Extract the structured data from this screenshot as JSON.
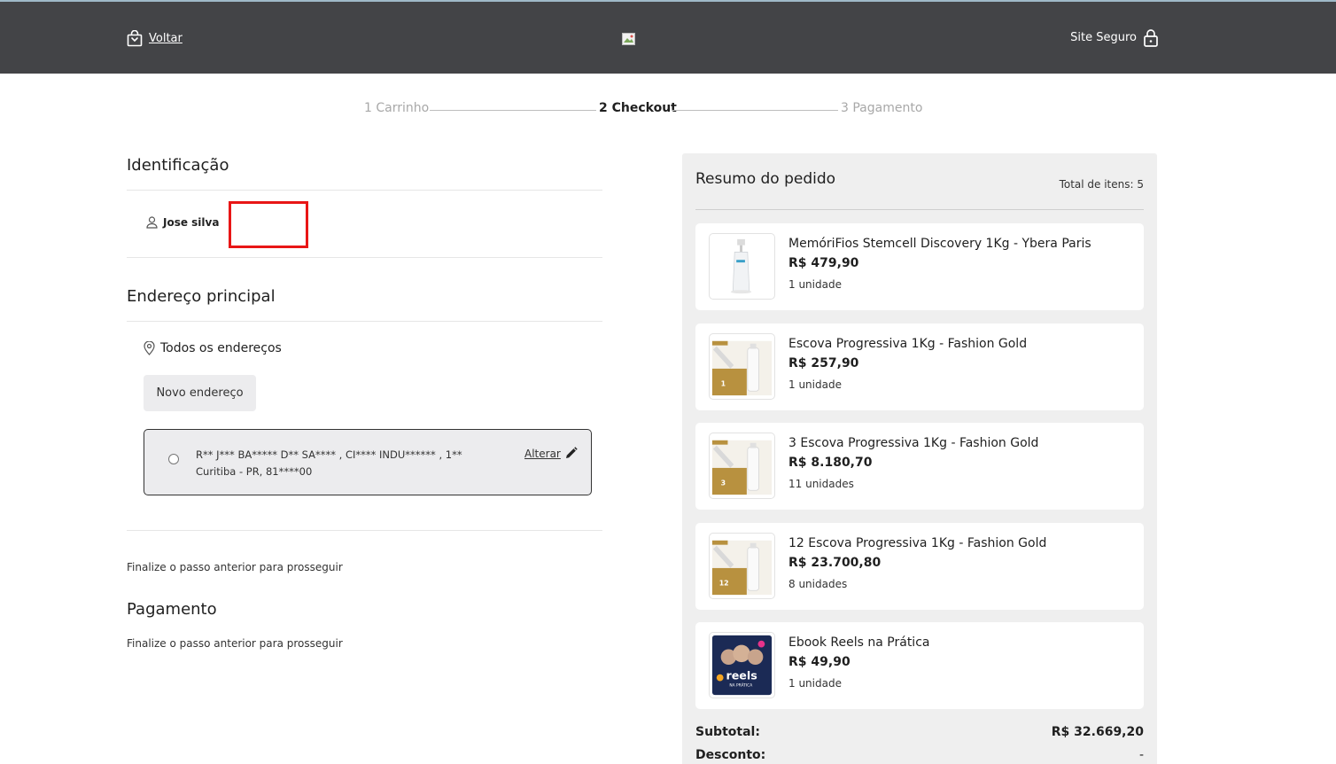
{
  "header": {
    "back_label": "Voltar",
    "secure_label": "Site Seguro"
  },
  "steps": [
    {
      "label": "1 Carrinho"
    },
    {
      "label": "2 Checkout"
    },
    {
      "label": "3 Pagamento"
    }
  ],
  "identification": {
    "title": "Identificação",
    "user_name": "Jose silva"
  },
  "address": {
    "title": "Endereço principal",
    "all_addresses_label": "Todos os endereços",
    "new_address_label": "Novo endereço",
    "line1": "R** J*** BA***** D** SA**** , CI**** INDU****** , 1**",
    "line2": "Curitiba - PR, 81****00",
    "edit_label": "Alterar"
  },
  "notes": {
    "after_address": "Finalize o passo anterior para prosseguir",
    "payment_title": "Pagamento",
    "after_payment": "Finalize o passo anterior para prosseguir"
  },
  "summary": {
    "title": "Resumo do pedido",
    "total_items": "Total de itens: 5",
    "items": [
      {
        "name": "MemóriFios Stemcell Discovery 1Kg - Ybera Paris",
        "price": "R$ 479,90",
        "qty": "1 unidade",
        "thumb": "bottle"
      },
      {
        "name": "Escova Progressiva 1Kg - Fashion Gold",
        "price": "R$ 257,90",
        "qty": "1 unidade",
        "thumb": "gold-box",
        "thumb_label": "1"
      },
      {
        "name": "3 Escova Progressiva 1Kg - Fashion Gold",
        "price": "R$ 8.180,70",
        "qty": "11 unidades",
        "thumb": "gold-box",
        "thumb_label": "3"
      },
      {
        "name": "12 Escova Progressiva 1Kg - Fashion Gold",
        "price": "R$ 23.700,80",
        "qty": "8 unidades",
        "thumb": "gold-box",
        "thumb_label": "12"
      },
      {
        "name": "Ebook Reels na Prática",
        "price": "R$ 49,90",
        "qty": "1 unidade",
        "thumb": "ebook",
        "thumb_label": "reels",
        "thumb_sublabel": "NA PRÁTICA"
      }
    ],
    "subtotal_label": "Subtotal:",
    "subtotal_value": "R$ 32.669,20",
    "discount_label": "Desconto:",
    "discount_value": "-"
  }
}
